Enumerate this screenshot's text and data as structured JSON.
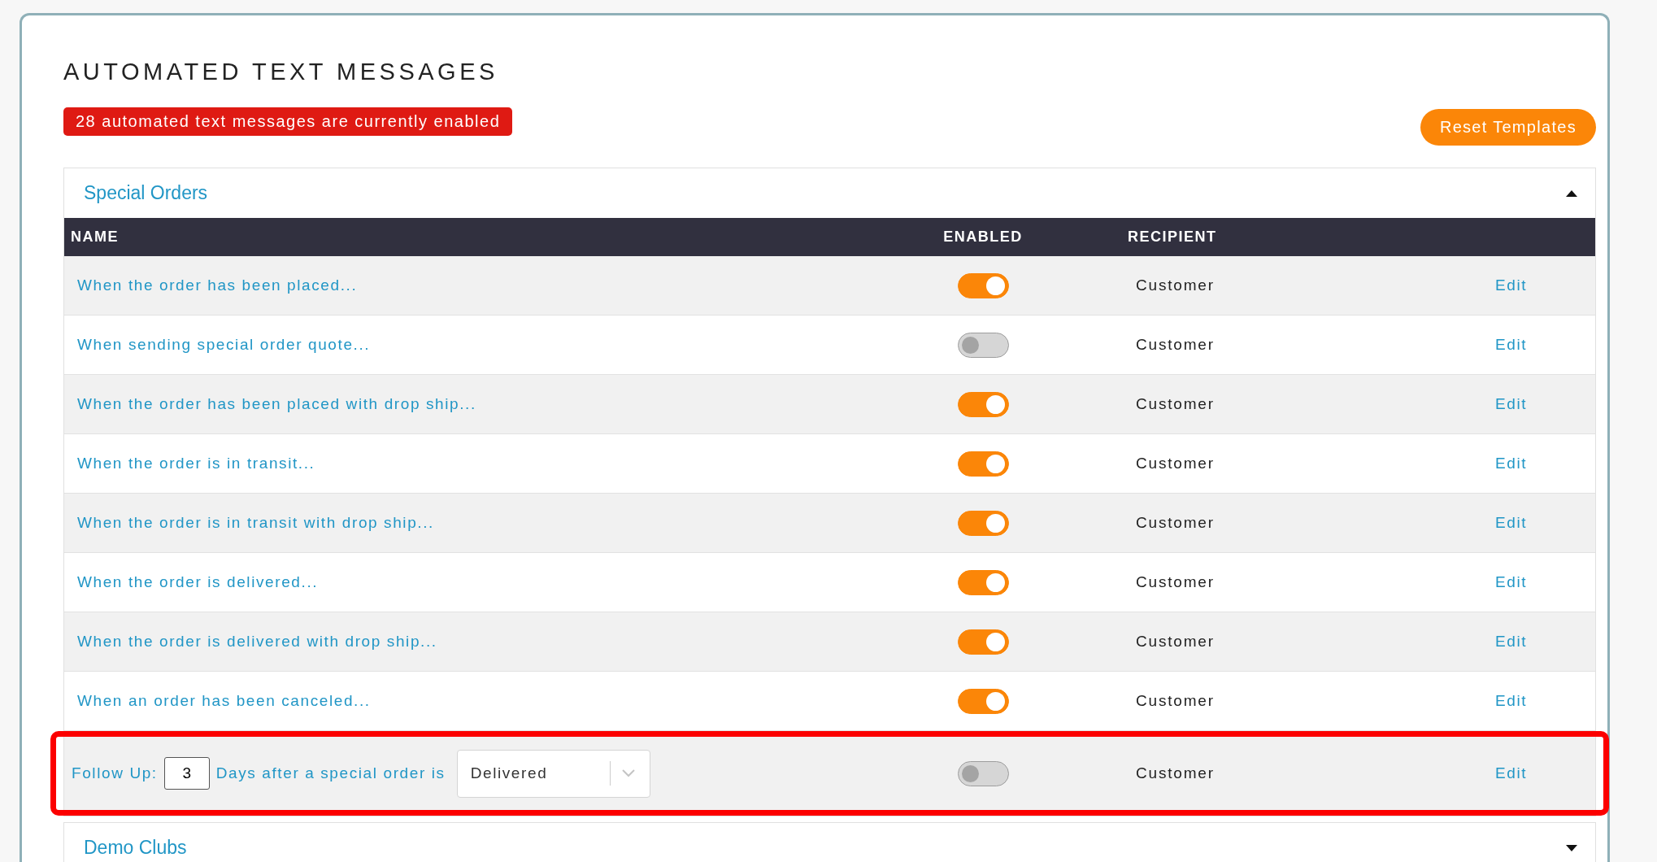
{
  "title": "AUTOMATED TEXT MESSAGES",
  "status_badge": "28 automated text messages are currently enabled",
  "reset_button": "Reset Templates",
  "sections": [
    {
      "title": "Special Orders",
      "expanded": true,
      "table": {
        "columns": [
          "NAME",
          "ENABLED",
          "RECIPIENT"
        ],
        "rows": [
          {
            "kind": "standard",
            "name": "When the order has been placed...",
            "on": true,
            "recipient": "Customer",
            "action": "Edit",
            "highlighted": false
          },
          {
            "kind": "standard",
            "name": "When sending special order quote...",
            "on": false,
            "recipient": "Customer",
            "action": "Edit",
            "highlighted": false
          },
          {
            "kind": "standard",
            "name": "When the order has been placed with drop ship...",
            "on": true,
            "recipient": "Customer",
            "action": "Edit",
            "highlighted": false
          },
          {
            "kind": "standard",
            "name": "When the order is in transit...",
            "on": true,
            "recipient": "Customer",
            "action": "Edit",
            "highlighted": false
          },
          {
            "kind": "standard",
            "name": "When the order is in transit with drop ship...",
            "on": true,
            "recipient": "Customer",
            "action": "Edit",
            "highlighted": false
          },
          {
            "kind": "standard",
            "name": "When the order is delivered...",
            "on": true,
            "recipient": "Customer",
            "action": "Edit",
            "highlighted": false
          },
          {
            "kind": "standard",
            "name": "When the order is delivered with drop ship...",
            "on": true,
            "recipient": "Customer",
            "action": "Edit",
            "highlighted": false
          },
          {
            "kind": "standard",
            "name": "When an order has been canceled...",
            "on": true,
            "recipient": "Customer",
            "action": "Edit",
            "highlighted": false
          },
          {
            "kind": "follow_up",
            "label": "Follow Up:",
            "days": "3",
            "middle_text": "Days after a special order is",
            "status_select": "Delivered",
            "on": false,
            "recipient": "Customer",
            "action": "Edit",
            "highlighted": true
          }
        ]
      }
    },
    {
      "title": "Demo Clubs",
      "expanded": false
    }
  ]
}
